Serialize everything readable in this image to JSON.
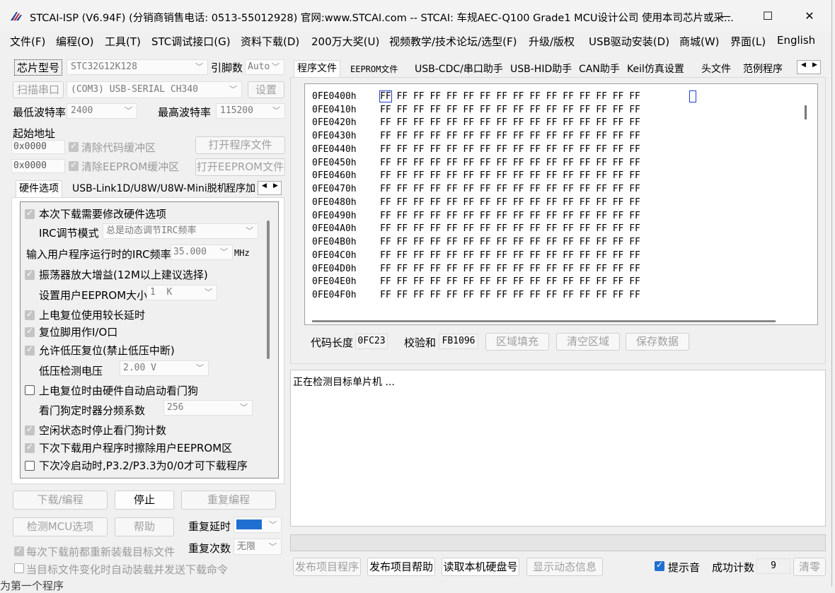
{
  "window": {
    "title": "STCAI-ISP (V6.94F) (分销商销售电话: 0513-55012928) 官网:www.STCAI.com  -- STCAI: 车规AEC-Q100 Grade1 MCU设计公司 使用本司芯片或采...",
    "minimize": "—",
    "maximize": "☐",
    "close": "✕"
  },
  "menu": [
    "文件(F)",
    "编程(O)",
    "工具(T)",
    "STC调试接口(G)",
    "资料下载(D)",
    "200万大奖(U)",
    "视频教学/技术论坛/选型(F)",
    "升级/版权",
    "USB驱动安装(D)",
    "商城(W)",
    "界面(L)",
    "English"
  ],
  "left": {
    "chip_type_label": "芯片型号",
    "chip_type_value": "STC32G12K128",
    "pins_label": "引脚数",
    "pins_value": "Auto",
    "scan_port_button": "扫描串口",
    "port_value": "(COM3) USB-SERIAL CH340",
    "settings_button": "设置",
    "min_baud_label": "最低波特率",
    "min_baud_value": "2400",
    "max_baud_label": "最高波特率",
    "max_baud_value": "115200",
    "start_addr_label": "起始地址",
    "code_addr_value": "0x0000",
    "clear_code_label": "清除代码缓冲区",
    "open_program_button": "打开程序文件",
    "eeprom_addr_value": "0x0000",
    "clear_eeprom_label": "清除EEPROM缓冲区",
    "open_eeprom_button": "打开EEPROM文件",
    "tabs": [
      "硬件选项",
      "USB-Link1D/U8W/U8W-Mini脱机",
      "程序加"
    ],
    "options": {
      "modify_hw": "本次下载需要修改硬件选项",
      "irc_mode_label": "IRC调节模式",
      "irc_mode_value": "总是动态调节IRC频率",
      "irc_freq_label": "输入用户程序运行时的IRC频率",
      "irc_freq_value": "35.000",
      "irc_freq_unit": "MHz",
      "osc_gain": "振荡器放大增益(12M以上建议选择)",
      "eeprom_size_label": "设置用户EEPROM大小",
      "eeprom_size_value": "1  K",
      "por_delay": "上电复位使用较长延时",
      "reset_pin_io": "复位脚用作I/O口",
      "lvd_reset": "允许低压复位(禁止低压中断)",
      "lvd_voltage_label": "低压检测电压",
      "lvd_voltage_value": "2.00 V",
      "wdt_autostart": "上电复位时由硬件自动启动看门狗",
      "wdt_prescale_label": "看门狗定时器分频系数",
      "wdt_prescale_value": "256",
      "idle_wdt_stop": "空闲状态时停止看门狗计数",
      "erase_eeprom": "下次下载用户程序时擦除用户EEPROM区",
      "cold_boot": "下次冷启动时,P3.2/P3.3为0/0才可下载程序"
    },
    "download_button": "下载/编程",
    "stop_button": "停止",
    "reprogram_button": "重复编程",
    "check_mcu_button": "检测MCU选项",
    "help_button": "帮助",
    "repeat_delay_label": "重复延时",
    "repeat_count_label": "重复次数",
    "repeat_count_value": "无限",
    "reload_label": "每次下载前都重新装载目标文件",
    "auto_load_label": "当目标文件变化时自动装载并发送下载命令",
    "bottom_clip": "为第一个程序"
  },
  "right": {
    "tabs": [
      "程序文件",
      "EEPROM文件",
      "USB-CDC/串口助手",
      "USB-HID助手",
      "CAN助手",
      "Keil仿真设置",
      "头文件",
      "范例程序"
    ],
    "hex_rows": [
      {
        "addr": "0FE0400h",
        "bytes": "FF FF FF FF FF FF FF FF FF FF FF FF FF FF FF FF"
      },
      {
        "addr": "0FE0410h",
        "bytes": "FF FF FF FF FF FF FF FF FF FF FF FF FF FF FF FF"
      },
      {
        "addr": "0FE0420h",
        "bytes": "FF FF FF FF FF FF FF FF FF FF FF FF FF FF FF FF"
      },
      {
        "addr": "0FE0430h",
        "bytes": "FF FF FF FF FF FF FF FF FF FF FF FF FF FF FF FF"
      },
      {
        "addr": "0FE0440h",
        "bytes": "FF FF FF FF FF FF FF FF FF FF FF FF FF FF FF FF"
      },
      {
        "addr": "0FE0450h",
        "bytes": "FF FF FF FF FF FF FF FF FF FF FF FF FF FF FF FF"
      },
      {
        "addr": "0FE0460h",
        "bytes": "FF FF FF FF FF FF FF FF FF FF FF FF FF FF FF FF"
      },
      {
        "addr": "0FE0470h",
        "bytes": "FF FF FF FF FF FF FF FF FF FF FF FF FF FF FF FF"
      },
      {
        "addr": "0FE0480h",
        "bytes": "FF FF FF FF FF FF FF FF FF FF FF FF FF FF FF FF"
      },
      {
        "addr": "0FE0490h",
        "bytes": "FF FF FF FF FF FF FF FF FF FF FF FF FF FF FF FF"
      },
      {
        "addr": "0FE04A0h",
        "bytes": "FF FF FF FF FF FF FF FF FF FF FF FF FF FF FF FF"
      },
      {
        "addr": "0FE04B0h",
        "bytes": "FF FF FF FF FF FF FF FF FF FF FF FF FF FF FF FF"
      },
      {
        "addr": "0FE04C0h",
        "bytes": "FF FF FF FF FF FF FF FF FF FF FF FF FF FF FF FF"
      },
      {
        "addr": "0FE04D0h",
        "bytes": "FF FF FF FF FF FF FF FF FF FF FF FF FF FF FF FF"
      },
      {
        "addr": "0FE04E0h",
        "bytes": "FF FF FF FF FF FF FF FF FF FF FF FF FF FF FF FF"
      },
      {
        "addr": "0FE04F0h",
        "bytes": "FF FF FF FF FF FF FF FF FF FF FF FF FF FF FF FF"
      }
    ],
    "code_length_label": "代码长度",
    "code_length_value": "0FC23",
    "checksum_label": "校验和",
    "checksum_value": "FB1096",
    "fill_button": "区域填充",
    "clear_button": "清空区域",
    "save_button": "保存数据",
    "log_text": "正在检测目标单片机 ...",
    "publish_button": "发布项目程序",
    "publish_help_button": "发布项目帮助",
    "read_disk_button": "读取本机硬盘号",
    "show_dynamic_button": "显示动态信息",
    "beep_label": "提示音",
    "success_count_label": "成功计数",
    "success_count_value": "9",
    "clear_count_button": "清零"
  },
  "colors": {
    "accent": "#1f6fd0",
    "hex_cursor": "#1f3fd0"
  }
}
